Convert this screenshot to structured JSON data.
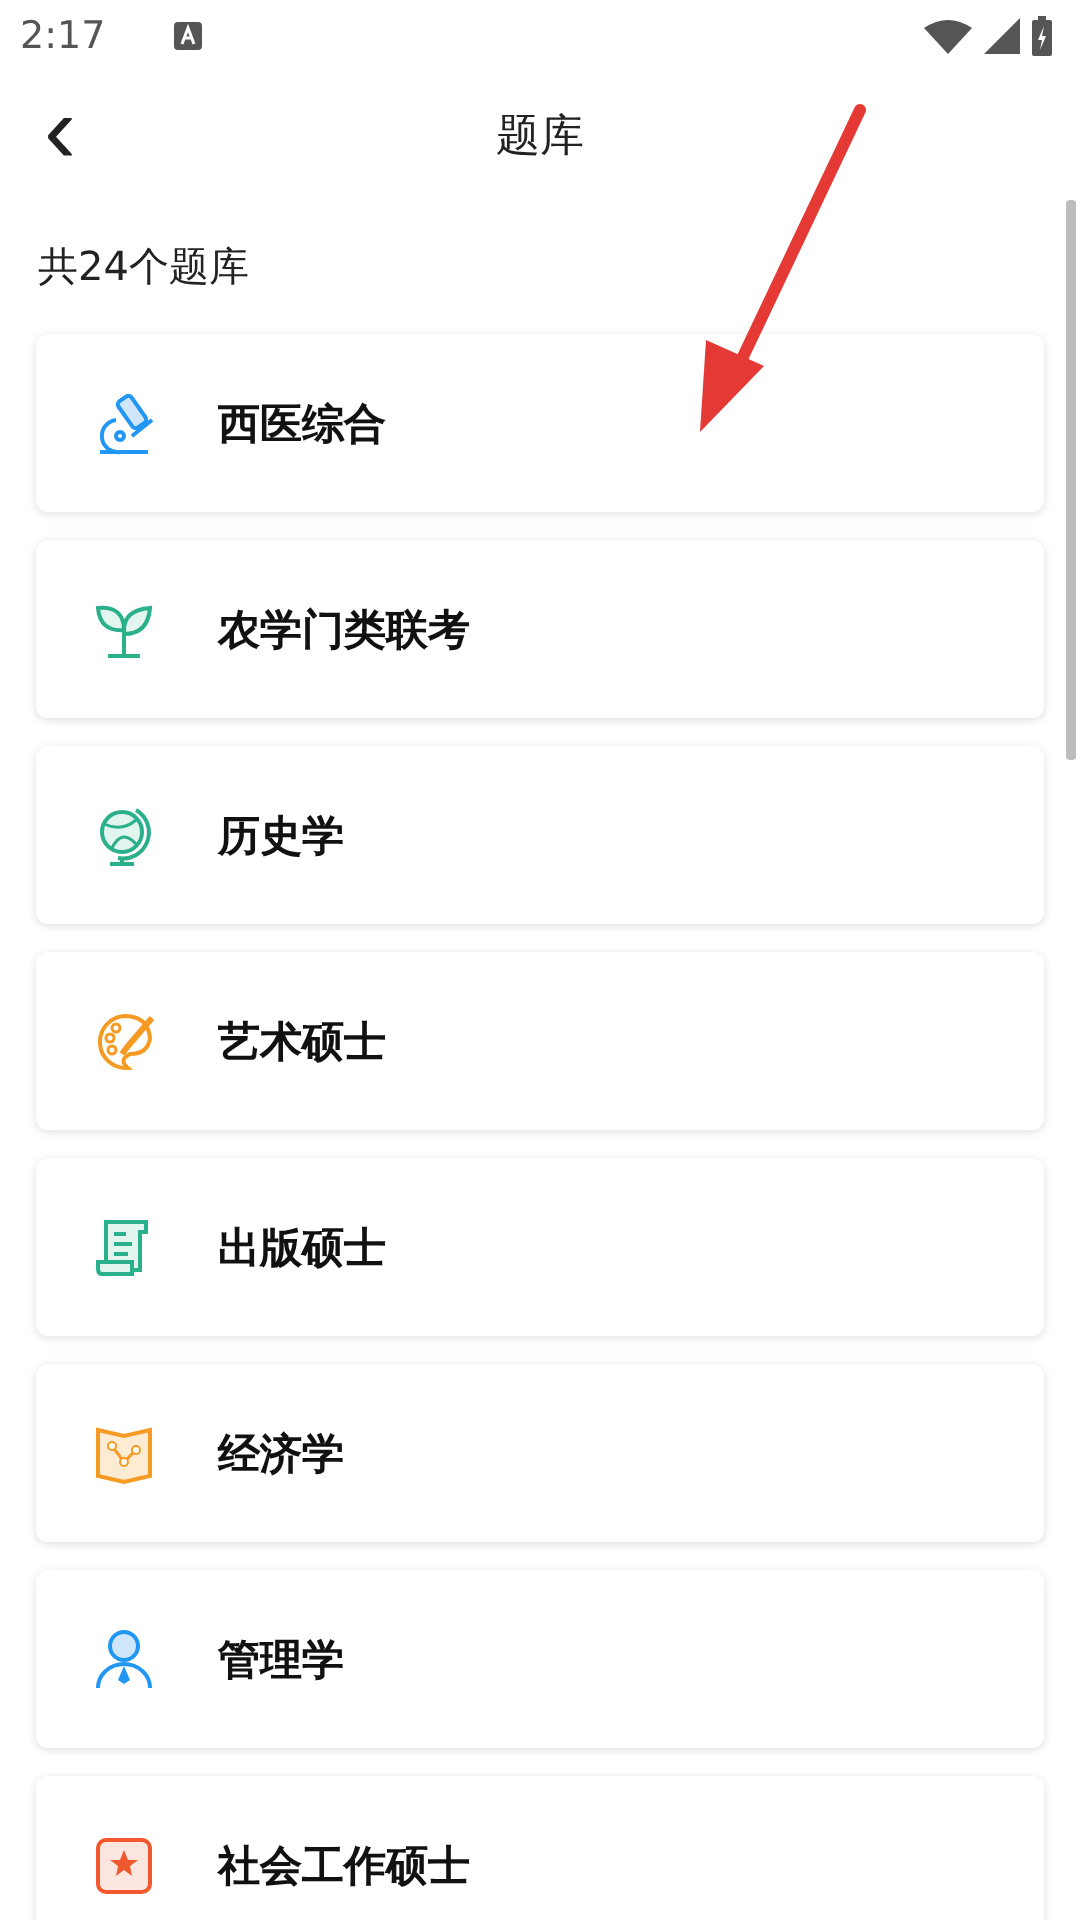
{
  "status_bar": {
    "time": "2:17"
  },
  "header": {
    "title": "题库",
    "back": "‹"
  },
  "summary": "共24个题库",
  "banks": [
    {
      "name": "西医综合"
    },
    {
      "name": "农学门类联考"
    },
    {
      "name": "历史学"
    },
    {
      "name": "艺术硕士"
    },
    {
      "name": "出版硕士"
    },
    {
      "name": "经济学"
    },
    {
      "name": "管理学"
    },
    {
      "name": "社会工作硕士"
    }
  ]
}
